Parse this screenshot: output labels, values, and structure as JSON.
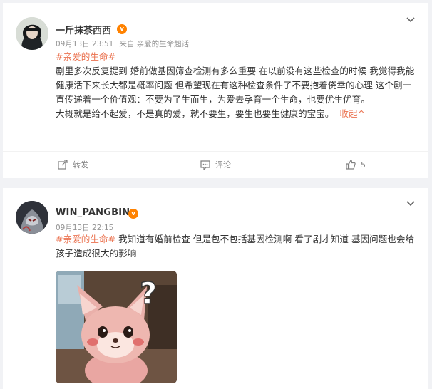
{
  "posts": [
    {
      "username": "一斤抹茶西西",
      "date": "09月13日 23:51",
      "source": "来自 亲爱的生命超话",
      "topic": "#亲爱的生命#",
      "paragraphs": [
        "剧里多次反复提到 婚前做基因筛查检测有多么重要 在以前没有这些检查的时候 我觉得我能健康活下来长大都是概率问题 但希望现在有这种检查条件了不要抱着侥幸的心理 这个剧一直传递着一个价值观：不要为了生而生，为爱去孕育一个生命，也要优生优育。",
        "大概就是给不起爱，不是真的爱，就不要生，要生也要生健康的宝宝。"
      ],
      "collapse_label": "收起^",
      "actions": {
        "repost": "转发",
        "comment": "评论",
        "like_count": "5"
      }
    },
    {
      "username": "WIN_PANGBIN",
      "date": "09月13日 22:15",
      "topic": "#亲爱的生命#",
      "text": "我知道有婚前检查 但是包不包括基因检测啊 看了剧才知道 基因问题也会给孩子造成很大的影响"
    }
  ],
  "colors": {
    "topic": "#eb7350",
    "vip": "#ff8200",
    "background": "#f1f2f5"
  },
  "icons": [
    "chevron-down-icon",
    "repost-icon",
    "comment-icon",
    "like-icon",
    "vip-badge-icon"
  ]
}
